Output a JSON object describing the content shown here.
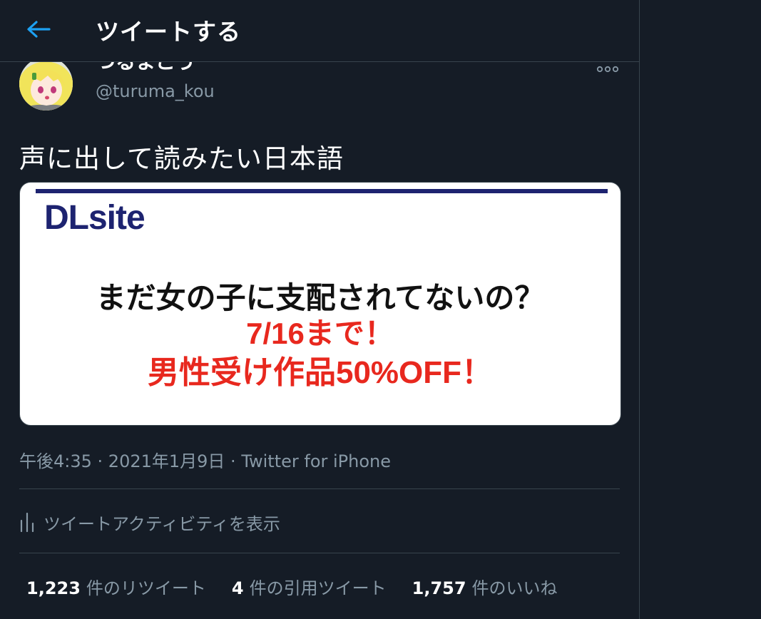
{
  "header": {
    "back_icon": "arrow-left-icon",
    "title": "ツイートする"
  },
  "tweet": {
    "display_name": "つるまこう",
    "handle": "@turuma_kou",
    "more_icon": "more-dots-icon",
    "text": "声に出して読みたい日本語",
    "media": {
      "logo": "DLsite",
      "line1": "まだ女の子に支配されてないの？",
      "line2": "7/16まで！",
      "line3": "男性受け作品50%OFF！"
    },
    "time": "午後4:35",
    "sep": " · ",
    "date": "2021年1月9日",
    "source": "Twitter for iPhone",
    "activity_icon": "bar-chart-icon",
    "activity_label": "ツイートアクティビティを表示"
  },
  "stats": {
    "retweets_count": "1,223",
    "retweets_label": "件のリツイート",
    "quotes_count": "4",
    "quotes_label": "件の引用ツイート",
    "likes_count": "1,757",
    "likes_label": "件のいいね"
  },
  "colors": {
    "background": "#151c26",
    "accent": "#1da1f2",
    "secondary_text": "#8899a6",
    "divider": "#38444d",
    "ad_red": "#e8281e",
    "ad_navy": "#1d2370"
  }
}
